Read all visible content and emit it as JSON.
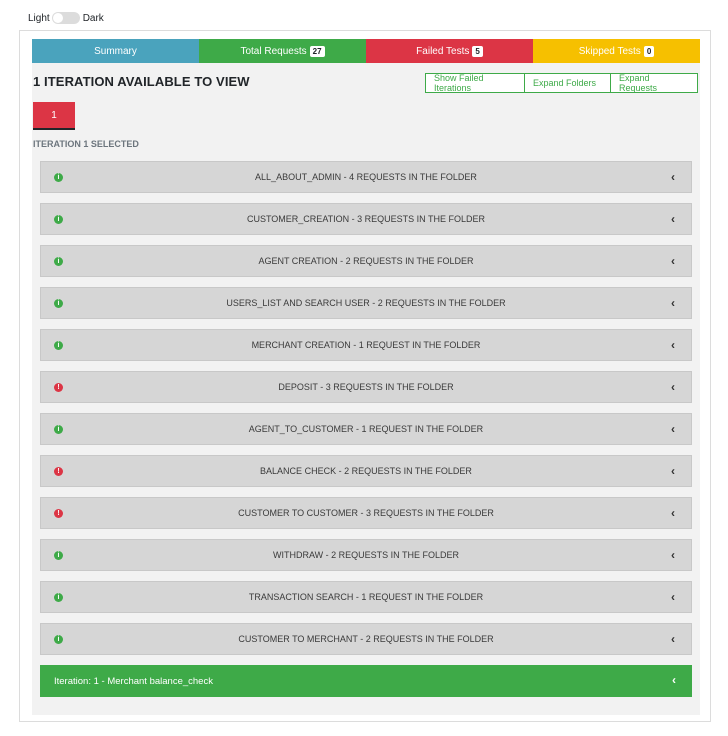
{
  "theme": {
    "light_label": "Light",
    "dark_label": "Dark"
  },
  "summary": [
    {
      "label": "Summary",
      "badge": null,
      "color": "#4aa3bd"
    },
    {
      "label": "Total Requests",
      "badge": "27",
      "color": "#3eaa48"
    },
    {
      "label": "Failed Tests",
      "badge": "5",
      "color": "#dc3545"
    },
    {
      "label": "Skipped Tests",
      "badge": "0",
      "color": "#f6c000"
    }
  ],
  "heading": "1 ITERATION AVAILABLE TO VIEW",
  "buttons": {
    "show_failed": "Show Failed Iterations",
    "expand_folders": "Expand Folders",
    "expand_requests": "Expand Requests"
  },
  "iteration_tab": "1",
  "selected_label": "ITERATION 1 SELECTED",
  "folders": [
    {
      "title": "ALL_ABOUT_ADMIN - 4 REQUESTS IN THE FOLDER",
      "status": "ok",
      "icon": "info-icon"
    },
    {
      "title": "CUSTOMER_CREATION - 3 REQUESTS IN THE FOLDER",
      "status": "ok",
      "icon": "info-icon"
    },
    {
      "title": "AGENT CREATION - 2 REQUESTS IN THE FOLDER",
      "status": "ok",
      "icon": "info-icon"
    },
    {
      "title": "USERS_LIST AND SEARCH USER - 2 REQUESTS IN THE FOLDER",
      "status": "ok",
      "icon": "info-icon"
    },
    {
      "title": "MERCHANT CREATION - 1 REQUEST IN THE FOLDER",
      "status": "ok",
      "icon": "info-icon"
    },
    {
      "title": "DEPOSIT - 3 REQUESTS IN THE FOLDER",
      "status": "fail",
      "icon": "error-icon"
    },
    {
      "title": "AGENT_TO_CUSTOMER - 1 REQUEST IN THE FOLDER",
      "status": "ok",
      "icon": "info-icon"
    },
    {
      "title": "BALANCE CHECK - 2 REQUESTS IN THE FOLDER",
      "status": "fail",
      "icon": "error-icon"
    },
    {
      "title": "CUSTOMER TO CUSTOMER - 3 REQUESTS IN THE FOLDER",
      "status": "fail",
      "icon": "error-icon"
    },
    {
      "title": "WITHDRAW - 2 REQUESTS IN THE FOLDER",
      "status": "ok",
      "icon": "info-icon"
    },
    {
      "title": "TRANSACTION SEARCH - 1 REQUEST IN THE FOLDER",
      "status": "ok",
      "icon": "info-icon"
    },
    {
      "title": "CUSTOMER TO MERCHANT - 2 REQUESTS IN THE FOLDER",
      "status": "ok",
      "icon": "info-icon"
    }
  ],
  "iteration_bar": {
    "label": "Iteration: 1 - Merchant balance_check",
    "icon": "chevron-left-icon"
  }
}
